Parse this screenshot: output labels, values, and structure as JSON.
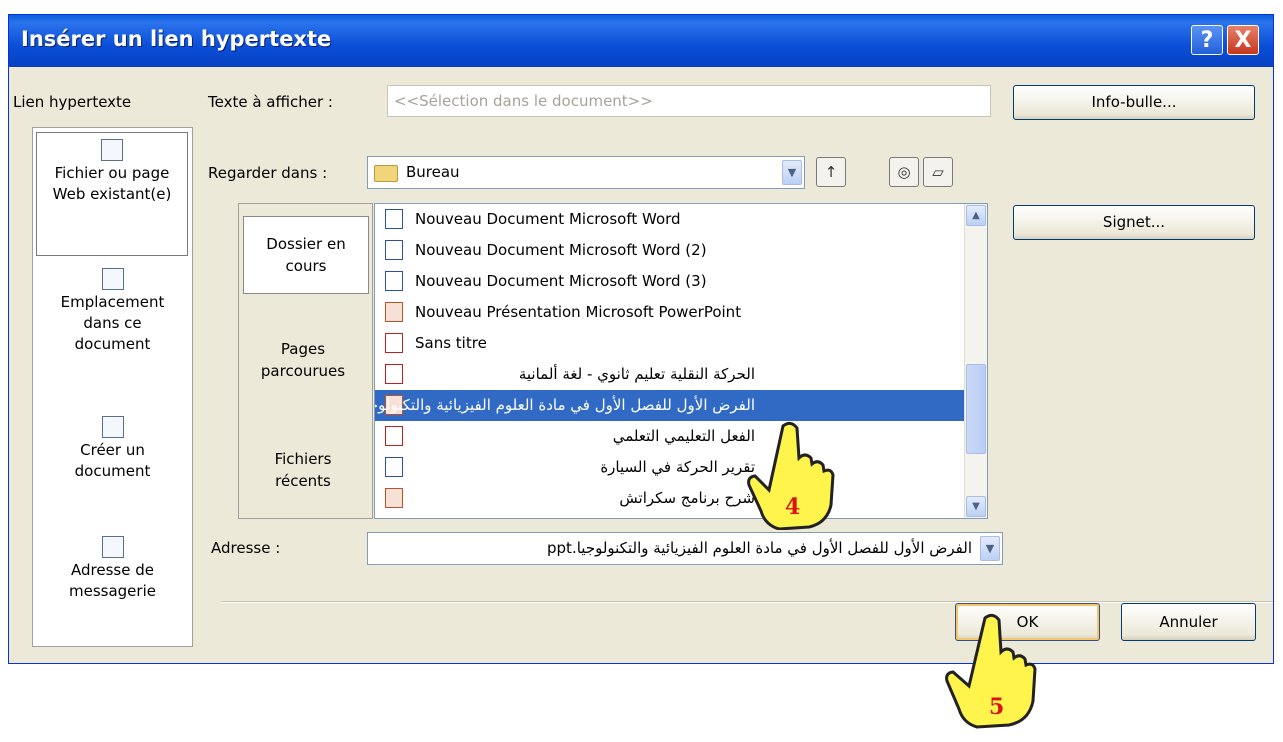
{
  "dialog": {
    "title": "Insérer un lien hypertexte",
    "help_label": "?",
    "close_label": "X"
  },
  "link_to": {
    "label": "Lien hypertexte",
    "items": [
      {
        "label": "Fichier ou page Web existant(e)",
        "icon": "web-page-file-icon",
        "selected": true
      },
      {
        "label": "Emplacement dans ce document",
        "icon": "place-in-document-icon"
      },
      {
        "label": "Créer un document",
        "icon": "new-document-icon"
      },
      {
        "label": "Adresse de messagerie",
        "icon": "email-address-icon"
      }
    ]
  },
  "text_to_display": {
    "label": "Texte à afficher :",
    "value": "<<Sélection dans le document>>"
  },
  "look_in": {
    "label": "Regarder dans :",
    "value": "Bureau",
    "icon": "folder-icon"
  },
  "tools": {
    "up_folder": "up-one-folder-icon",
    "browse_web": "browse-web-icon",
    "browse_file": "browse-file-icon"
  },
  "inner_tabs": [
    {
      "label": "Dossier en cours",
      "selected": true
    },
    {
      "label": "Pages parcourues"
    },
    {
      "label": "Fichiers récents"
    }
  ],
  "files": [
    {
      "name": "Nouveau Document Microsoft Word",
      "type": "word"
    },
    {
      "name": "Nouveau Document Microsoft Word (2)",
      "type": "word"
    },
    {
      "name": "Nouveau Document Microsoft Word (3)",
      "type": "word"
    },
    {
      "name": "Nouveau Présentation Microsoft PowerPoint",
      "type": "ppt"
    },
    {
      "name": "Sans titre",
      "type": "pdf"
    },
    {
      "name": "الحركة النقلية تعليم ثانوي - لغة ألمانية",
      "type": "pdf",
      "rtl": true
    },
    {
      "name": "الفرض الأول للفصل الأول في مادة العلوم الفيزيائية والتكنولوجيا",
      "type": "ppt",
      "rtl": true,
      "selected": true
    },
    {
      "name": "الفعل التعليمي التعلمي",
      "type": "pdf",
      "rtl": true
    },
    {
      "name": "تقرير الحركة في السيارة",
      "type": "word",
      "rtl": true
    },
    {
      "name": "شرح برنامج سكراتش",
      "type": "ppt",
      "rtl": true
    }
  ],
  "address": {
    "label": "Adresse :",
    "value": "الفرض الأول للفصل الأول في مادة العلوم الفيزيائية والتكنولوجيا.ppt"
  },
  "buttons": {
    "screentip": "Info-bulle...",
    "bookmark": "Signet...",
    "ok": "OK",
    "cancel": "Annuler"
  },
  "annotations": {
    "step4": "4",
    "step5": "5"
  }
}
